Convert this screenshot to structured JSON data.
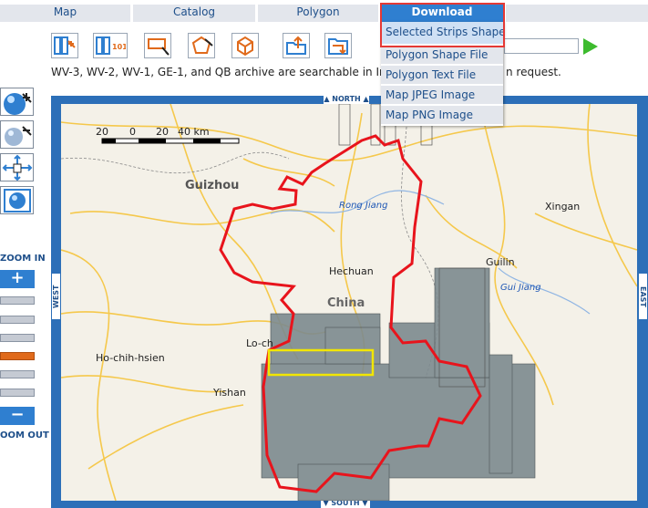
{
  "tabs": [
    {
      "label": "Map"
    },
    {
      "label": "Catalog"
    },
    {
      "label": "Polygon"
    },
    {
      "label": "Download"
    }
  ],
  "download_menu": {
    "items": [
      {
        "label": "Selected Strips Shape File"
      },
      {
        "label": "Polygon Shape File"
      },
      {
        "label": "Polygon Text File"
      },
      {
        "label": "Map JPEG Image"
      },
      {
        "label": "Map PNG Image"
      }
    ]
  },
  "notice": "WV-3, WV-2, WV-1, GE-1, and QB archive are searchable in ImageFinder.",
  "notice_tail": "n request.",
  "zoom": {
    "in_label": "ZOOM IN",
    "out_label": "OOM OUT",
    "plus": "+",
    "minus": "−",
    "level_index": 3
  },
  "compass": {
    "north": "NORTH",
    "south": "SOUTH",
    "west": "WEST",
    "east": "EAST"
  },
  "scale": {
    "ticks": [
      "20",
      "0",
      "20",
      "40 km"
    ]
  },
  "map": {
    "places": [
      {
        "name": "Guizhou"
      },
      {
        "name": "Rong Jiang"
      },
      {
        "name": "Xingan"
      },
      {
        "name": "Guilin"
      },
      {
        "name": "Gui Jiang"
      },
      {
        "name": "Hechuan"
      },
      {
        "name": "China"
      },
      {
        "name": "Lo-ch"
      },
      {
        "name": "Ho-chih-hsien"
      },
      {
        "name": "Yishan"
      }
    ]
  },
  "colors": {
    "accent": "#2f7fd0",
    "polygon": "#e8141c",
    "selected_strip": "#f2e600",
    "highlight": "#e53935"
  }
}
